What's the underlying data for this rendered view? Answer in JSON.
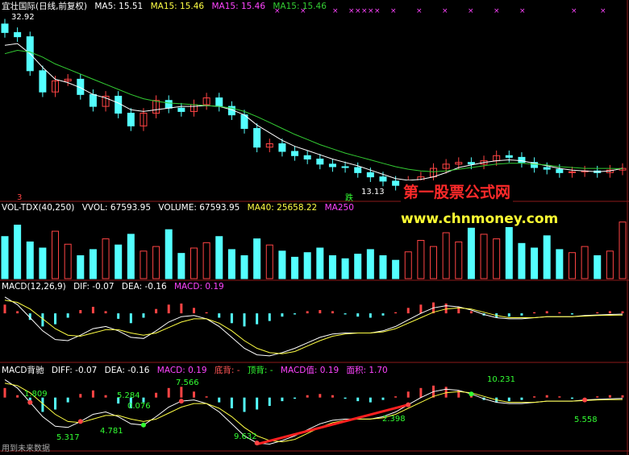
{
  "headers": {
    "price": {
      "name": "宜壮国际(日线,前复权)",
      "ma5": "MA5: 15.51",
      "ma15a": "MA15: 15.46",
      "ma15b": "MA15: 15.46",
      "ma15c": "MA15: 15.46"
    },
    "vol": {
      "name": "VOL-TDX(40,250)",
      "vvol": "VVOL: 67593.95",
      "volume": "VOLUME: 67593.95",
      "ma40": "MA40: 25658.22",
      "ma250": "MA250"
    },
    "macd": {
      "name": "MACD(12,26,9)",
      "dif": "DIF: -0.07",
      "dea": "DEA: -0.16",
      "macd": "MACD: 0.19"
    },
    "macd2": {
      "name": "MACD背驰",
      "diff": "DIFF: -0.07",
      "dea": "DEA: -0.16",
      "macd": "MACD: 0.19",
      "bottom": "底背: -",
      "top": "顶背: -",
      "macdval": "MACD值: 0.19",
      "area": "面积: 1.70"
    }
  },
  "watermark": {
    "line1": "第一股票公式网",
    "line2": "www.chnmoney.com"
  },
  "annotations": {
    "high": "32.92",
    "low": "13.13",
    "low_mark": "跌",
    "vol_mark": "3"
  },
  "macd2_labels": [
    "1.809",
    "5.317",
    "4.781",
    "0.076",
    "7.566",
    "5.284",
    "9.632",
    "2.398",
    "10.231",
    "5.558"
  ],
  "footer": "用到未来数据",
  "colors": {
    "up": "#ff4444",
    "down": "#54ffff",
    "ma5": "#ffffff",
    "ma15": "#33cc33",
    "macd_yellow": "#ffff44",
    "divergence": "#ff2020"
  },
  "chart_data": [
    {
      "type": "candlestick",
      "title": "宜壮国际(日线,前复权)",
      "ylim": [
        12,
        34
      ],
      "annotations": [
        "32.92",
        "13.13"
      ],
      "series": [
        {
          "name": "close",
          "values": [
            31.5,
            31.0,
            27.0,
            24.5,
            25.8,
            26.0,
            24.2,
            22.8,
            24.0,
            22.0,
            20.5,
            22.0,
            23.5,
            22.6,
            22.2,
            23.0,
            23.8,
            22.8,
            21.8,
            20.2,
            18.0,
            18.4,
            17.5,
            17.0,
            16.6,
            16.0,
            15.7,
            15.6,
            15.0,
            14.5,
            14.0,
            13.5,
            14.0,
            14.5,
            15.5,
            16.0,
            16.2,
            16.0,
            16.4,
            17.0,
            16.8,
            16.2,
            15.6,
            15.4,
            15.0,
            15.1,
            15.2,
            15.0,
            15.3,
            15.5
          ]
        },
        {
          "name": "MA5",
          "values": [
            30.0,
            30.2,
            29.0,
            27.4,
            26.0,
            25.6,
            25.0,
            24.2,
            23.8,
            23.2,
            22.4,
            22.2,
            22.4,
            22.6,
            22.8,
            22.8,
            22.9,
            22.8,
            22.4,
            21.8,
            20.6,
            19.7,
            18.8,
            18.1,
            17.6,
            17.1,
            16.6,
            16.2,
            15.8,
            15.3,
            14.8,
            14.3,
            14.1,
            14.2,
            14.5,
            15.0,
            15.6,
            15.9,
            16.2,
            16.4,
            16.5,
            16.4,
            16.1,
            15.8,
            15.5,
            15.3,
            15.2,
            15.1,
            15.2,
            15.51
          ]
        },
        {
          "name": "MA15",
          "values": [
            29.0,
            29.4,
            29.2,
            28.6,
            27.8,
            27.2,
            26.6,
            26.0,
            25.4,
            24.8,
            24.2,
            23.7,
            23.4,
            23.2,
            23.1,
            23.0,
            22.9,
            22.8,
            22.6,
            22.2,
            21.6,
            20.9,
            20.2,
            19.5,
            18.9,
            18.3,
            17.8,
            17.3,
            16.9,
            16.5,
            16.1,
            15.7,
            15.4,
            15.2,
            15.1,
            15.2,
            15.4,
            15.6,
            15.8,
            16.0,
            16.1,
            16.1,
            16.0,
            15.9,
            15.7,
            15.6,
            15.5,
            15.5,
            15.5,
            15.46
          ]
        }
      ]
    },
    {
      "type": "bar",
      "title": "VOL-TDX(40,250)",
      "series": [
        {
          "name": "VOLUME",
          "values": [
            55,
            70,
            48,
            40,
            62,
            45,
            30,
            38,
            52,
            44,
            58,
            36,
            42,
            64,
            33,
            40,
            47,
            55,
            38,
            30,
            52,
            44,
            36,
            28,
            34,
            40,
            30,
            26,
            32,
            38,
            30,
            24,
            35,
            50,
            42,
            60,
            48,
            66,
            58,
            52,
            70,
            46,
            40,
            56,
            38,
            34,
            42,
            30,
            36,
            74
          ]
        }
      ]
    },
    {
      "type": "bar",
      "title": "MACD(12,26,9)",
      "series": [
        {
          "name": "MACD",
          "values": [
            0.8,
            0.2,
            -0.6,
            -1.2,
            -1.0,
            -0.4,
            0.3,
            0.6,
            0.2,
            -0.5,
            -0.9,
            -0.4,
            0.4,
            0.8,
            0.9,
            0.5,
            0.1,
            -0.4,
            -0.9,
            -1.2,
            -1.0,
            -0.7,
            -0.3,
            -0.1,
            0.2,
            0.3,
            0.2,
            -0.1,
            -0.3,
            -0.4,
            -0.2,
            0.1,
            0.5,
            0.8,
            1.0,
            0.9,
            0.6,
            0.2,
            -0.2,
            -0.4,
            -0.3,
            -0.2,
            0.1,
            0.2,
            0.1,
            -0.1,
            0.0,
            0.1,
            0.2,
            0.19
          ]
        },
        {
          "name": "DIF",
          "values": [
            1.5,
            0.8,
            -0.4,
            -1.6,
            -2.4,
            -2.5,
            -2.0,
            -1.4,
            -1.2,
            -1.6,
            -2.2,
            -2.3,
            -1.6,
            -0.8,
            -0.3,
            -0.2,
            -0.5,
            -1.2,
            -2.2,
            -3.2,
            -3.8,
            -3.9,
            -3.6,
            -3.2,
            -2.7,
            -2.2,
            -1.9,
            -1.8,
            -1.8,
            -1.8,
            -1.6,
            -1.2,
            -0.6,
            0.0,
            0.5,
            0.7,
            0.6,
            0.3,
            -0.1,
            -0.4,
            -0.5,
            -0.5,
            -0.4,
            -0.3,
            -0.3,
            -0.3,
            -0.2,
            -0.15,
            -0.1,
            -0.07
          ]
        },
        {
          "name": "DEA",
          "values": [
            1.2,
            1.0,
            0.4,
            -0.5,
            -1.4,
            -2.0,
            -2.1,
            -1.8,
            -1.5,
            -1.5,
            -1.8,
            -2.0,
            -1.8,
            -1.3,
            -0.8,
            -0.5,
            -0.5,
            -0.9,
            -1.6,
            -2.5,
            -3.2,
            -3.6,
            -3.7,
            -3.5,
            -3.0,
            -2.5,
            -2.1,
            -1.9,
            -1.8,
            -1.8,
            -1.7,
            -1.4,
            -0.9,
            -0.4,
            0.1,
            0.4,
            0.5,
            0.4,
            0.1,
            -0.2,
            -0.4,
            -0.4,
            -0.4,
            -0.3,
            -0.3,
            -0.3,
            -0.25,
            -0.2,
            -0.18,
            -0.16
          ]
        }
      ]
    },
    {
      "type": "bar",
      "title": "MACD背驰",
      "series": [
        {
          "name": "MACD",
          "values": [
            0.8,
            0.2,
            -0.6,
            -1.2,
            -1.0,
            -0.4,
            0.3,
            0.6,
            0.2,
            -0.5,
            -0.9,
            -0.4,
            0.4,
            0.8,
            0.9,
            0.5,
            0.1,
            -0.4,
            -0.9,
            -1.2,
            -1.0,
            -0.7,
            -0.3,
            -0.1,
            0.2,
            0.3,
            0.2,
            -0.1,
            -0.3,
            -0.4,
            -0.2,
            0.1,
            0.5,
            0.8,
            1.0,
            0.9,
            0.6,
            0.2,
            -0.2,
            -0.4,
            -0.3,
            -0.2,
            0.1,
            0.2,
            0.1,
            -0.1,
            0.0,
            0.1,
            0.2,
            0.19
          ]
        },
        {
          "name": "DIFF",
          "values": [
            1.5,
            0.8,
            -0.4,
            -1.6,
            -2.4,
            -2.5,
            -2.0,
            -1.4,
            -1.2,
            -1.6,
            -2.2,
            -2.3,
            -1.6,
            -0.8,
            -0.3,
            -0.2,
            -0.5,
            -1.2,
            -2.2,
            -3.2,
            -3.8,
            -3.9,
            -3.6,
            -3.2,
            -2.7,
            -2.2,
            -1.9,
            -1.8,
            -1.8,
            -1.8,
            -1.6,
            -1.2,
            -0.6,
            0.0,
            0.5,
            0.7,
            0.6,
            0.3,
            -0.1,
            -0.4,
            -0.5,
            -0.5,
            -0.4,
            -0.3,
            -0.3,
            -0.3,
            -0.2,
            -0.15,
            -0.1,
            -0.07
          ]
        },
        {
          "name": "DEA",
          "values": [
            1.2,
            1.0,
            0.4,
            -0.5,
            -1.4,
            -2.0,
            -2.1,
            -1.8,
            -1.5,
            -1.5,
            -1.8,
            -2.0,
            -1.8,
            -1.3,
            -0.8,
            -0.5,
            -0.5,
            -0.9,
            -1.6,
            -2.5,
            -3.2,
            -3.6,
            -3.7,
            -3.5,
            -3.0,
            -2.5,
            -2.1,
            -1.9,
            -1.8,
            -1.8,
            -1.7,
            -1.4,
            -0.9,
            -0.4,
            0.1,
            0.4,
            0.5,
            0.4,
            0.1,
            -0.2,
            -0.4,
            -0.4,
            -0.4,
            -0.3,
            -0.3,
            -0.3,
            -0.25,
            -0.2,
            -0.18,
            -0.16
          ]
        }
      ]
    }
  ]
}
